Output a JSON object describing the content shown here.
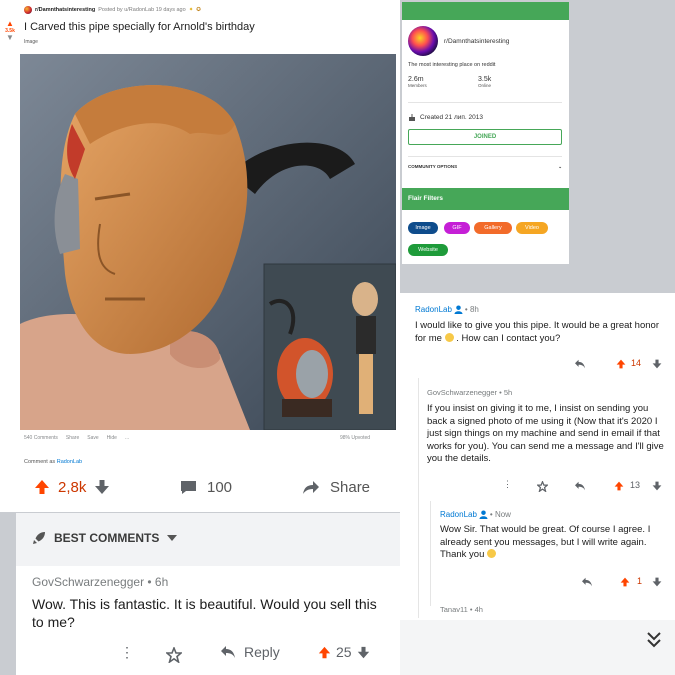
{
  "post": {
    "subreddit": "r/Damnthatsinteresting",
    "posted_by": "Posted by u/RadonLab 19 days ago",
    "side_score": "3.5k",
    "title": "I Carved this pipe specially for Arnold's birthday",
    "flair": "Image",
    "action_comments": "540 Comments",
    "action_share": "Share",
    "action_save": "Save",
    "action_hide": "Hide",
    "action_more": "...",
    "upvoted": "98% Upvoted",
    "comment_as_prefix": "Comment as",
    "comment_as_user": "RadonLab",
    "score": "2,8k",
    "comments_count": "100",
    "share_label": "Share"
  },
  "best_comments": {
    "label": "BEST COMMENTS",
    "comment": {
      "author_line": "GovSchwarzenegger • 6h",
      "body": "Wow. This is fantastic. It is beautiful. Would you sell this to me?",
      "reply_label": "Reply",
      "score": "25"
    }
  },
  "sidebar": {
    "subreddit": "r/Damnthatsinteresting",
    "description": "The most interesting place on reddit",
    "members_count": "2.6m",
    "members_label": "Members",
    "online_count": "3.5k",
    "online_label": "Online",
    "created": "Created 21 лип. 2013",
    "joined_label": "JOINED",
    "community_options": "COMMUNITY OPTIONS",
    "flair_title": "Flair Filters",
    "flairs": [
      {
        "label": "Image",
        "color": "#0e4c8c"
      },
      {
        "label": "GIF",
        "color": "#c51fd6"
      },
      {
        "label": "Gallery",
        "color": "#f26b2a"
      },
      {
        "label": "Video",
        "color": "#f5a623"
      },
      {
        "label": "Website",
        "color": "#1e9b3a"
      }
    ]
  },
  "thread": {
    "c1": {
      "author": "RadonLab",
      "time": "• 8h",
      "body_1": "I would like to give you this pipe.  It would be a great honor for me",
      "body_2": ".  How can I contact you?",
      "score": "14"
    },
    "c2": {
      "author_line": "GovSchwarzenegger • 5h",
      "body": "If you insist on giving it to me, I insist on sending you back a signed photo of me using it (Now that it's 2020 I just sign things on my machine and send in email if that works for you). You can send me a message and I'll give you the details.",
      "score": "13"
    },
    "c3": {
      "author": "RadonLab",
      "time": "• Now",
      "body": "Wow Sir. That would be great. Of course I agree. I already sent you messages, but I will write again. Thank you",
      "score": "1"
    },
    "c4": {
      "author_line": "Tanav11 • 4h"
    }
  },
  "colors": {
    "upvote": "#ff4500",
    "score_text": "#cc3700",
    "sidebar_green": "#46a758",
    "link_blue": "#0079d3"
  },
  "icons": [
    "upvote-arrow-icon",
    "downvote-arrow-icon",
    "comment-bubble-icon",
    "share-arrow-icon",
    "rocket-icon",
    "caret-down-icon",
    "more-dots-icon",
    "award-icon",
    "reply-arrow-icon",
    "cake-icon",
    "user-badge-icon",
    "chevron-double-down-icon"
  ]
}
